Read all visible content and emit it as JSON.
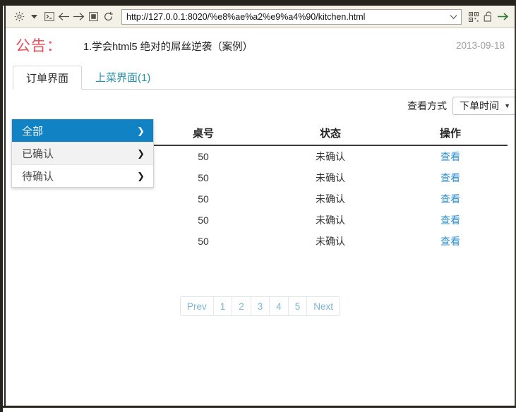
{
  "browser": {
    "url": "http://127.0.0.1:8020/%e8%ae%a2%e9%a4%90/kitchen.html",
    "toolbar_icons": [
      "gear-icon",
      "caret-down-icon",
      "console-icon",
      "back-arrow-icon",
      "forward-arrow-icon",
      "stop-icon",
      "reload-icon"
    ],
    "url_chevron_icon": "chevron-down-icon",
    "right_icons": [
      "qrcode-icon",
      "padlock-open-icon",
      "go-arrow-icon"
    ]
  },
  "announcement": {
    "label": "公告：",
    "text": "1.学会html5 绝对的屌丝逆袭（案例）",
    "date": "2013-09-18",
    "label_color": "#e8505a",
    "date_color": "#9d9d9d"
  },
  "tabs": [
    {
      "label": "订单界面",
      "active": true
    },
    {
      "label": "上菜界面(1)",
      "active": false
    }
  ],
  "viewmode": {
    "label": "查看方式",
    "selected": "下单时间",
    "caret_icon": "caret-down-icon"
  },
  "menu": {
    "items": [
      {
        "label": "全部",
        "selected": true,
        "chevron_icon": "chevron-right-icon"
      },
      {
        "label": "已确认",
        "selected": false,
        "chevron_icon": "chevron-right-icon"
      },
      {
        "label": "待确认",
        "selected": false,
        "chevron_icon": "chevron-right-icon"
      }
    ],
    "highlight_color": "#1183c4"
  },
  "table": {
    "headers": [
      "",
      "桌号",
      "状态",
      "操作"
    ],
    "rows": [
      {
        "name": "",
        "table_no": "50",
        "status": "未确认",
        "action": "查看"
      },
      {
        "name": "",
        "table_no": "50",
        "status": "未确认",
        "action": "查看"
      },
      {
        "name": "",
        "table_no": "50",
        "status": "未确认",
        "action": "查看"
      },
      {
        "name": "",
        "table_no": "50",
        "status": "未确认",
        "action": "查看"
      },
      {
        "name": "",
        "table_no": "50",
        "status": "未确认",
        "action": "查看"
      }
    ],
    "link_color": "#2f8fd0"
  },
  "pagination": {
    "prev": "Prev",
    "pages": [
      "1",
      "2",
      "3",
      "4",
      "5"
    ],
    "next": "Next",
    "link_color": "#7eb4d6"
  }
}
